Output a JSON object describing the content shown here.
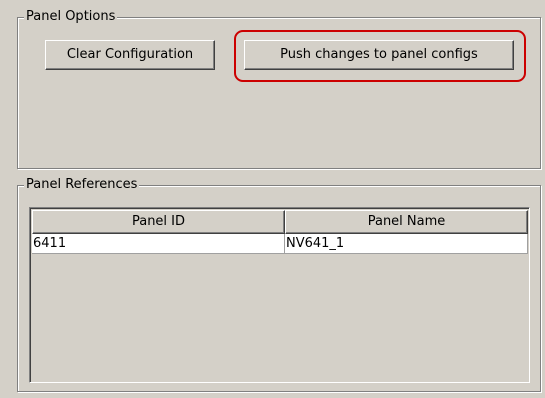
{
  "panel_options": {
    "title": "Panel Options",
    "clear_label": "Clear Configuration",
    "push_label": "Push changes to panel configs",
    "highlight_color": "#cc0000"
  },
  "panel_references": {
    "title": "Panel References",
    "columns": [
      "Panel ID",
      "Panel Name"
    ],
    "rows": [
      [
        "6411",
        "NV641_1"
      ]
    ]
  }
}
